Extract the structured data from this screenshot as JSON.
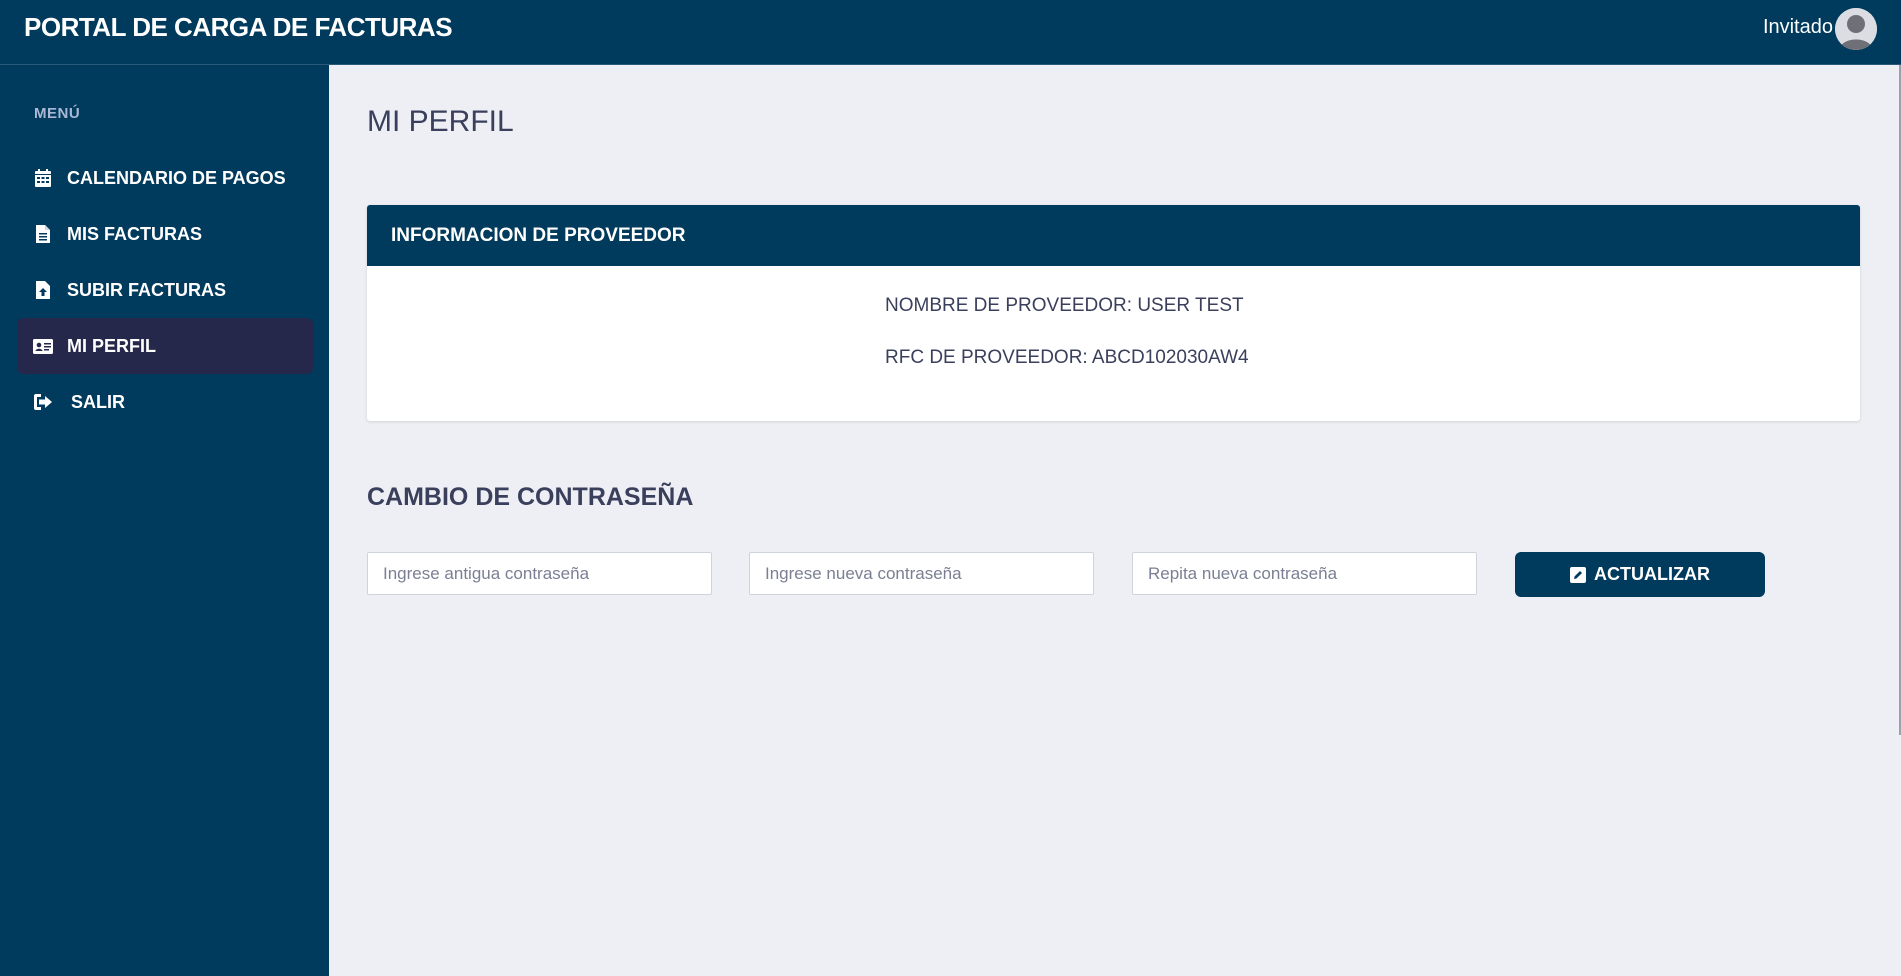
{
  "header": {
    "app_title": "PORTAL DE CARGA DE FACTURAS",
    "user_name": "Invitado"
  },
  "sidebar": {
    "heading": "MENÚ",
    "items": [
      {
        "label": "CALENDARIO DE PAGOS",
        "icon": "calendar-icon",
        "active": false
      },
      {
        "label": "MIS FACTURAS",
        "icon": "file-text-icon",
        "active": false
      },
      {
        "label": "SUBIR FACTURAS",
        "icon": "file-upload-icon",
        "active": false
      },
      {
        "label": "MI PERFIL",
        "icon": "id-card-icon",
        "active": true
      },
      {
        "label": "SALIR",
        "icon": "sign-out-icon",
        "active": false
      }
    ]
  },
  "main": {
    "page_title": "MI PERFIL",
    "provider_card": {
      "header": "INFORMACION DE PROVEEDOR",
      "name_line": "NOMBRE DE PROVEEDOR: USER TEST",
      "rfc_line": "RFC DE PROVEEDOR: ABCD102030AW4"
    },
    "password_section": {
      "title": "CAMBIO DE CONTRASEÑA",
      "old_password_placeholder": "Ingrese antigua contraseña",
      "new_password_placeholder": "Ingrese nueva contraseña",
      "repeat_password_placeholder": "Repita nueva contraseña",
      "update_label": "ACTUALIZAR",
      "update_icon": "edit-icon"
    }
  },
  "colors": {
    "primary": "#003a5c",
    "active_item": "#25284a",
    "background": "#edeff4",
    "text": "#3a3f5c",
    "menu_heading": "#a9b8d6"
  }
}
